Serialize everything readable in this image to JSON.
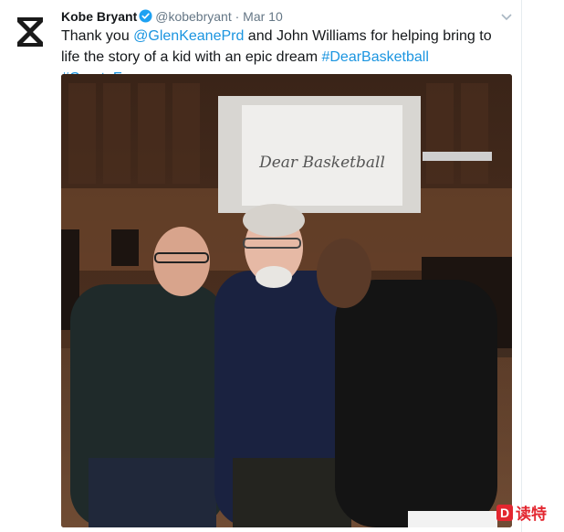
{
  "tweet": {
    "author_name": "Kobe Bryant",
    "handle": "@kobebryant",
    "separator": "·",
    "timestamp": "Mar 10",
    "text_parts": {
      "p1": "Thank you ",
      "mention1": "@GlenKeanePrd",
      "p2": " and John Williams for helping bring to life the story of a kid with an epic dream ",
      "hashtag1": "#DearBasketball",
      "space": " ",
      "hashtag2": "#CreateForever"
    },
    "verified_icon": "verified-badge-icon",
    "menu_icon": "chevron-down-icon",
    "avatar_icon": "hourglass-logo-icon"
  },
  "photo": {
    "screen_text": "Dear Basketball"
  },
  "watermark": {
    "logo_letter": "D",
    "text": "读特"
  },
  "colors": {
    "link": "#1b95e0",
    "text": "#14171a",
    "muted": "#657786",
    "verified": "#1da1f2",
    "watermark": "#e3262f"
  }
}
